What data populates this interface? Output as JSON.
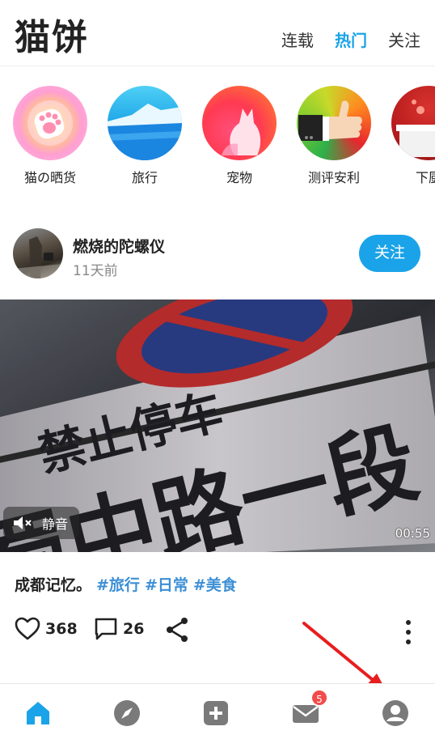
{
  "header": {
    "title": "猫饼",
    "tabs": [
      {
        "label": "连载",
        "active": false
      },
      {
        "label": "热门",
        "active": true
      },
      {
        "label": "关注",
        "active": false
      }
    ]
  },
  "categories": [
    {
      "label": "猫の晒货",
      "icon": "cat-paw-icon"
    },
    {
      "label": "旅行",
      "icon": "mountain-sea-icon"
    },
    {
      "label": "宠物",
      "icon": "cat-silhouette-icon"
    },
    {
      "label": "测评安利",
      "icon": "thumbs-up-icon"
    },
    {
      "label": "下厨",
      "icon": "cooking-pot-icon"
    }
  ],
  "post": {
    "author": "燃烧的陀螺仪",
    "time": "11天前",
    "follow_label": "关注",
    "video": {
      "mute_label": "静音",
      "duration": "00:55",
      "sign_line1": "禁止停车",
      "sign_line2": "蜀中路一段"
    },
    "caption": "成都记忆。",
    "tags": [
      "#旅行",
      "#日常",
      "#美食"
    ],
    "likes": "368",
    "comments": "26"
  },
  "nav": {
    "items": [
      "home-icon",
      "compass-icon",
      "plus-icon",
      "mail-icon",
      "profile-icon"
    ],
    "mail_badge": "5",
    "accent": "#1aa3e8"
  }
}
